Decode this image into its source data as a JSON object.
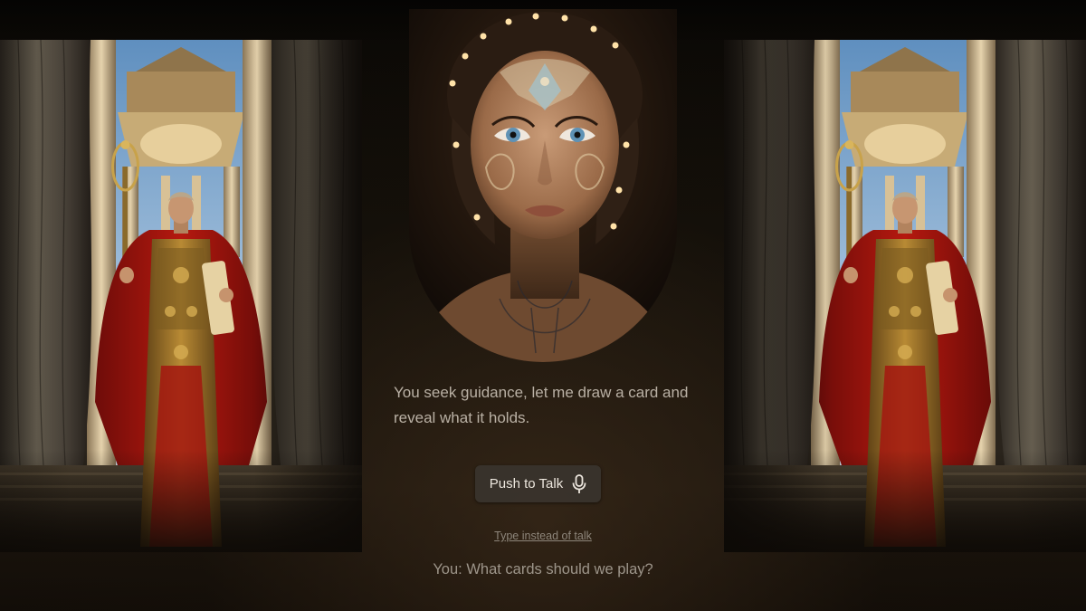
{
  "oracle": {
    "message": "You seek guidance, let me draw a card and reveal what it holds."
  },
  "controls": {
    "push_to_talk_label": "Push to Talk",
    "push_to_talk_icon": "microphone-icon",
    "type_instead_label": "Type instead of talk"
  },
  "transcript": {
    "user_line": "You: What cards should we play?"
  },
  "colors": {
    "background": "#0c0905",
    "text": "#b9b0a4",
    "button_bg": "#3a342e",
    "robe_red": "#a3160f",
    "gold": "#c8a24a"
  }
}
